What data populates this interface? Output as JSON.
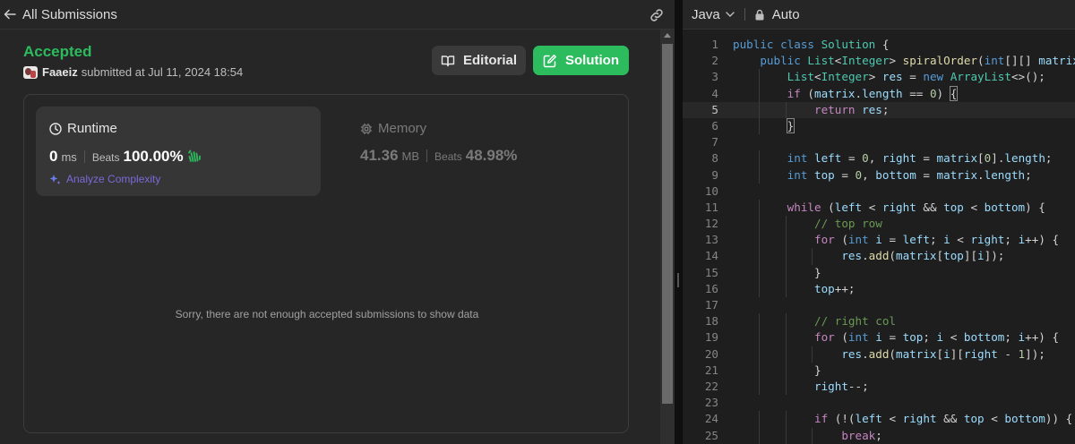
{
  "left_header": {
    "back_label": "All Submissions"
  },
  "submission": {
    "status": "Accepted",
    "user": "Faaeiz",
    "submitted_text": "submitted at Jul 11, 2024 18:54"
  },
  "buttons": {
    "editorial": "Editorial",
    "solution": "Solution"
  },
  "runtime": {
    "title": "Runtime",
    "value": "0",
    "unit": "ms",
    "beats_label": "Beats",
    "beats_pct": "100.00%",
    "analyze": "Analyze Complexity"
  },
  "memory": {
    "title": "Memory",
    "value": "41.36",
    "unit": "MB",
    "beats_label": "Beats",
    "beats_pct": "48.98%"
  },
  "empty_message": "Sorry, there are not enough accepted submissions to show data",
  "editor": {
    "language": "Java",
    "mode": "Auto",
    "active_line": 5,
    "lines": [
      [
        [
          "kw",
          "public "
        ],
        [
          "kw",
          "class "
        ],
        [
          "ty",
          "Solution"
        ],
        [
          "p",
          " {"
        ]
      ],
      [
        [
          "p",
          "    "
        ],
        [
          "kw",
          "public "
        ],
        [
          "ty",
          "List"
        ],
        [
          "p",
          "<"
        ],
        [
          "ty",
          "Integer"
        ],
        [
          "p",
          "> "
        ],
        [
          "fn",
          "spiralOrder"
        ],
        [
          "p",
          "("
        ],
        [
          "kw",
          "int"
        ],
        [
          "p",
          "[][] "
        ],
        [
          "vr",
          "matrix"
        ],
        [
          "p",
          ") {"
        ]
      ],
      [
        [
          "p",
          "        "
        ],
        [
          "ty",
          "List"
        ],
        [
          "p",
          "<"
        ],
        [
          "ty",
          "Integer"
        ],
        [
          "p",
          "> "
        ],
        [
          "vr",
          "res"
        ],
        [
          "p",
          " = "
        ],
        [
          "kw",
          "new "
        ],
        [
          "ty",
          "ArrayList"
        ],
        [
          "p",
          "<>();"
        ]
      ],
      [
        [
          "p",
          "        "
        ],
        [
          "kw2",
          "if"
        ],
        [
          "p",
          " ("
        ],
        [
          "vr",
          "matrix"
        ],
        [
          "p",
          "."
        ],
        [
          "vr",
          "length"
        ],
        [
          "p",
          " == "
        ],
        [
          "nm",
          "0"
        ],
        [
          "p",
          ") "
        ],
        [
          "bm",
          "{"
        ]
      ],
      [
        [
          "p",
          "            "
        ],
        [
          "kw2",
          "return "
        ],
        [
          "vr",
          "res"
        ],
        [
          "p",
          ";"
        ]
      ],
      [
        [
          "p",
          "        "
        ],
        [
          "bm",
          "}"
        ]
      ],
      [
        [
          "p",
          ""
        ]
      ],
      [
        [
          "p",
          "        "
        ],
        [
          "kw",
          "int "
        ],
        [
          "vr",
          "left"
        ],
        [
          "p",
          " = "
        ],
        [
          "nm",
          "0"
        ],
        [
          "p",
          ", "
        ],
        [
          "vr",
          "right"
        ],
        [
          "p",
          " = "
        ],
        [
          "vr",
          "matrix"
        ],
        [
          "p",
          "["
        ],
        [
          "nm",
          "0"
        ],
        [
          "p",
          "]."
        ],
        [
          "vr",
          "length"
        ],
        [
          "p",
          ";"
        ]
      ],
      [
        [
          "p",
          "        "
        ],
        [
          "kw",
          "int "
        ],
        [
          "vr",
          "top"
        ],
        [
          "p",
          " = "
        ],
        [
          "nm",
          "0"
        ],
        [
          "p",
          ", "
        ],
        [
          "vr",
          "bottom"
        ],
        [
          "p",
          " = "
        ],
        [
          "vr",
          "matrix"
        ],
        [
          "p",
          "."
        ],
        [
          "vr",
          "length"
        ],
        [
          "p",
          ";"
        ]
      ],
      [
        [
          "p",
          ""
        ]
      ],
      [
        [
          "p",
          "        "
        ],
        [
          "kw2",
          "while"
        ],
        [
          "p",
          " ("
        ],
        [
          "vr",
          "left"
        ],
        [
          "p",
          " < "
        ],
        [
          "vr",
          "right"
        ],
        [
          "p",
          " && "
        ],
        [
          "vr",
          "top"
        ],
        [
          "p",
          " < "
        ],
        [
          "vr",
          "bottom"
        ],
        [
          "p",
          ") {"
        ]
      ],
      [
        [
          "p",
          "            "
        ],
        [
          "cm",
          "// top row"
        ]
      ],
      [
        [
          "p",
          "            "
        ],
        [
          "kw2",
          "for"
        ],
        [
          "p",
          " ("
        ],
        [
          "kw",
          "int "
        ],
        [
          "vr",
          "i"
        ],
        [
          "p",
          " = "
        ],
        [
          "vr",
          "left"
        ],
        [
          "p",
          "; "
        ],
        [
          "vr",
          "i"
        ],
        [
          "p",
          " < "
        ],
        [
          "vr",
          "right"
        ],
        [
          "p",
          "; "
        ],
        [
          "vr",
          "i"
        ],
        [
          "p",
          "++) {"
        ]
      ],
      [
        [
          "p",
          "                "
        ],
        [
          "vr",
          "res"
        ],
        [
          "p",
          "."
        ],
        [
          "fn",
          "add"
        ],
        [
          "p",
          "("
        ],
        [
          "vr",
          "matrix"
        ],
        [
          "p",
          "["
        ],
        [
          "vr",
          "top"
        ],
        [
          "p",
          "]["
        ],
        [
          "vr",
          "i"
        ],
        [
          "p",
          "]);"
        ]
      ],
      [
        [
          "p",
          "            }"
        ]
      ],
      [
        [
          "p",
          "            "
        ],
        [
          "vr",
          "top"
        ],
        [
          "p",
          "++;"
        ]
      ],
      [
        [
          "p",
          ""
        ]
      ],
      [
        [
          "p",
          "            "
        ],
        [
          "cm",
          "// right col"
        ]
      ],
      [
        [
          "p",
          "            "
        ],
        [
          "kw2",
          "for"
        ],
        [
          "p",
          " ("
        ],
        [
          "kw",
          "int "
        ],
        [
          "vr",
          "i"
        ],
        [
          "p",
          " = "
        ],
        [
          "vr",
          "top"
        ],
        [
          "p",
          "; "
        ],
        [
          "vr",
          "i"
        ],
        [
          "p",
          " < "
        ],
        [
          "vr",
          "bottom"
        ],
        [
          "p",
          "; "
        ],
        [
          "vr",
          "i"
        ],
        [
          "p",
          "++) {"
        ]
      ],
      [
        [
          "p",
          "                "
        ],
        [
          "vr",
          "res"
        ],
        [
          "p",
          "."
        ],
        [
          "fn",
          "add"
        ],
        [
          "p",
          "("
        ],
        [
          "vr",
          "matrix"
        ],
        [
          "p",
          "["
        ],
        [
          "vr",
          "i"
        ],
        [
          "p",
          "]["
        ],
        [
          "vr",
          "right"
        ],
        [
          "p",
          " - "
        ],
        [
          "nm",
          "1"
        ],
        [
          "p",
          "]);"
        ]
      ],
      [
        [
          "p",
          "            }"
        ]
      ],
      [
        [
          "p",
          "            "
        ],
        [
          "vr",
          "right"
        ],
        [
          "p",
          "--;"
        ]
      ],
      [
        [
          "p",
          ""
        ]
      ],
      [
        [
          "p",
          "            "
        ],
        [
          "kw2",
          "if"
        ],
        [
          "p",
          " (!("
        ],
        [
          "vr",
          "left"
        ],
        [
          "p",
          " < "
        ],
        [
          "vr",
          "right"
        ],
        [
          "p",
          " && "
        ],
        [
          "vr",
          "top"
        ],
        [
          "p",
          " < "
        ],
        [
          "vr",
          "bottom"
        ],
        [
          "p",
          ")) {"
        ]
      ],
      [
        [
          "p",
          "                "
        ],
        [
          "kw2",
          "break"
        ],
        [
          "p",
          ";"
        ]
      ]
    ]
  }
}
